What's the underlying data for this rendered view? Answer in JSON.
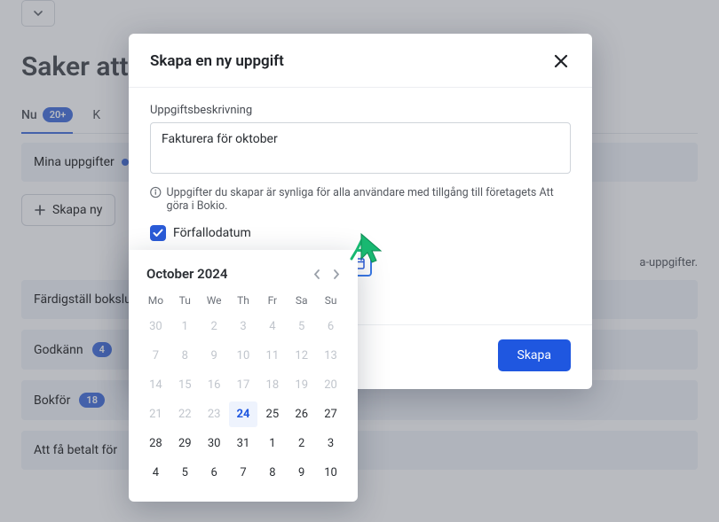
{
  "page": {
    "title": "Saker att göra",
    "tabs": [
      {
        "label": "Nu",
        "badge": "20+",
        "active": true
      },
      {
        "label": "K",
        "active": false
      }
    ],
    "subhead": "Mina uppgifter",
    "create_button": "Skapa ny",
    "note_suffix": "a-uppgifter.",
    "rows": [
      {
        "label": "Färdigställ bokslut",
        "badge": ""
      },
      {
        "label": "Godkänn",
        "badge": "4"
      },
      {
        "label": "Bokför",
        "badge": "18"
      },
      {
        "label": "Att få betalt för",
        "badge": ""
      }
    ]
  },
  "modal": {
    "title": "Skapa en ny uppgift",
    "desc_label": "Uppgiftsbeskrivning",
    "desc_value": "Fakturera för oktober",
    "info_text": "Uppgifter du skapar är synliga för alla användare med tillgång till företagets Att göra i Bokio.",
    "due_checkbox_label": "Förfallodatum",
    "due_checked": true,
    "date_value": "2024-10-24",
    "submit_label": "Skapa",
    "hidden_btn_fragment": "la"
  },
  "calendar": {
    "title": "October 2024",
    "dow": [
      "Mo",
      "Tu",
      "We",
      "Th",
      "Fr",
      "Sa",
      "Su"
    ],
    "weeks": [
      [
        {
          "n": 30,
          "m": true
        },
        {
          "n": 1,
          "m": true
        },
        {
          "n": 2,
          "m": true
        },
        {
          "n": 3,
          "m": true
        },
        {
          "n": 4,
          "m": true
        },
        {
          "n": 5,
          "m": true
        },
        {
          "n": 6,
          "m": true
        }
      ],
      [
        {
          "n": 7,
          "m": true
        },
        {
          "n": 8,
          "m": true
        },
        {
          "n": 9,
          "m": true
        },
        {
          "n": 10,
          "m": true
        },
        {
          "n": 11,
          "m": true
        },
        {
          "n": 12,
          "m": true
        },
        {
          "n": 13,
          "m": true
        }
      ],
      [
        {
          "n": 14,
          "m": true
        },
        {
          "n": 15,
          "m": true
        },
        {
          "n": 16,
          "m": true
        },
        {
          "n": 17,
          "m": true
        },
        {
          "n": 18,
          "m": true
        },
        {
          "n": 19,
          "m": true
        },
        {
          "n": 20,
          "m": true
        }
      ],
      [
        {
          "n": 21,
          "m": true
        },
        {
          "n": 22,
          "m": true
        },
        {
          "n": 23,
          "m": true
        },
        {
          "n": 24,
          "sel": true
        },
        {
          "n": 25
        },
        {
          "n": 26
        },
        {
          "n": 27
        }
      ],
      [
        {
          "n": 28
        },
        {
          "n": 29
        },
        {
          "n": 30
        },
        {
          "n": 31
        },
        {
          "n": 1,
          "o": true
        },
        {
          "n": 2,
          "o": true
        },
        {
          "n": 3,
          "o": true
        }
      ],
      [
        {
          "n": 4,
          "o": true
        },
        {
          "n": 5,
          "o": true
        },
        {
          "n": 6,
          "o": true
        },
        {
          "n": 7,
          "o": true
        },
        {
          "n": 8,
          "o": true
        },
        {
          "n": 9,
          "o": true
        },
        {
          "n": 10,
          "o": true
        }
      ]
    ]
  },
  "colors": {
    "accent": "#1f57e0"
  }
}
